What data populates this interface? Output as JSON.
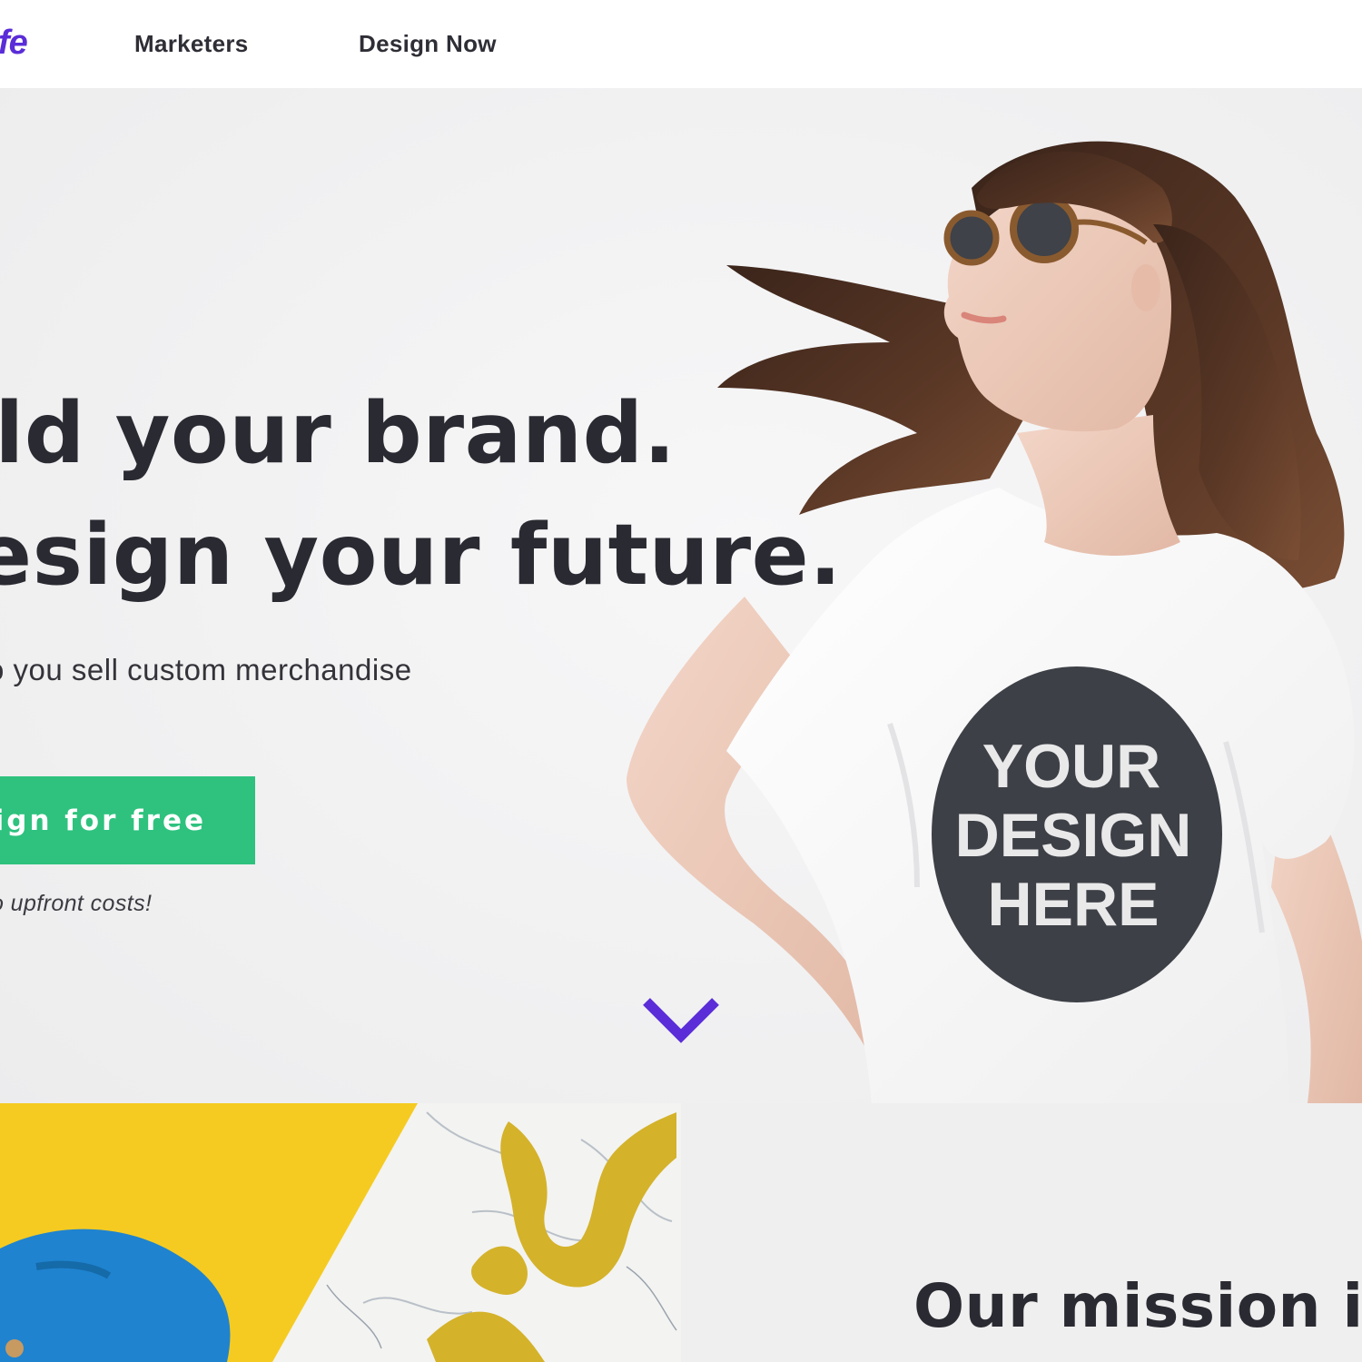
{
  "header": {
    "logo_text": "fe",
    "nav": {
      "marketers": "Marketers",
      "design_now": "Design Now"
    }
  },
  "hero": {
    "headline_line1": "ild your brand.",
    "headline_line2": "esign your future.",
    "subtext": "o you sell custom merchandise",
    "cta_label": "ign for free",
    "note": "o upfront costs!",
    "shirt_text": [
      "YOUR",
      "DESIGN",
      "HERE"
    ]
  },
  "mission": {
    "heading": "Our mission is"
  },
  "colors": {
    "brand_purple": "#5a2dd8",
    "cta_green": "#2ec27e",
    "text_dark": "#2a2a32",
    "yellow": "#f5cb22"
  },
  "icons": {
    "scroll": "chevron-down-icon"
  }
}
